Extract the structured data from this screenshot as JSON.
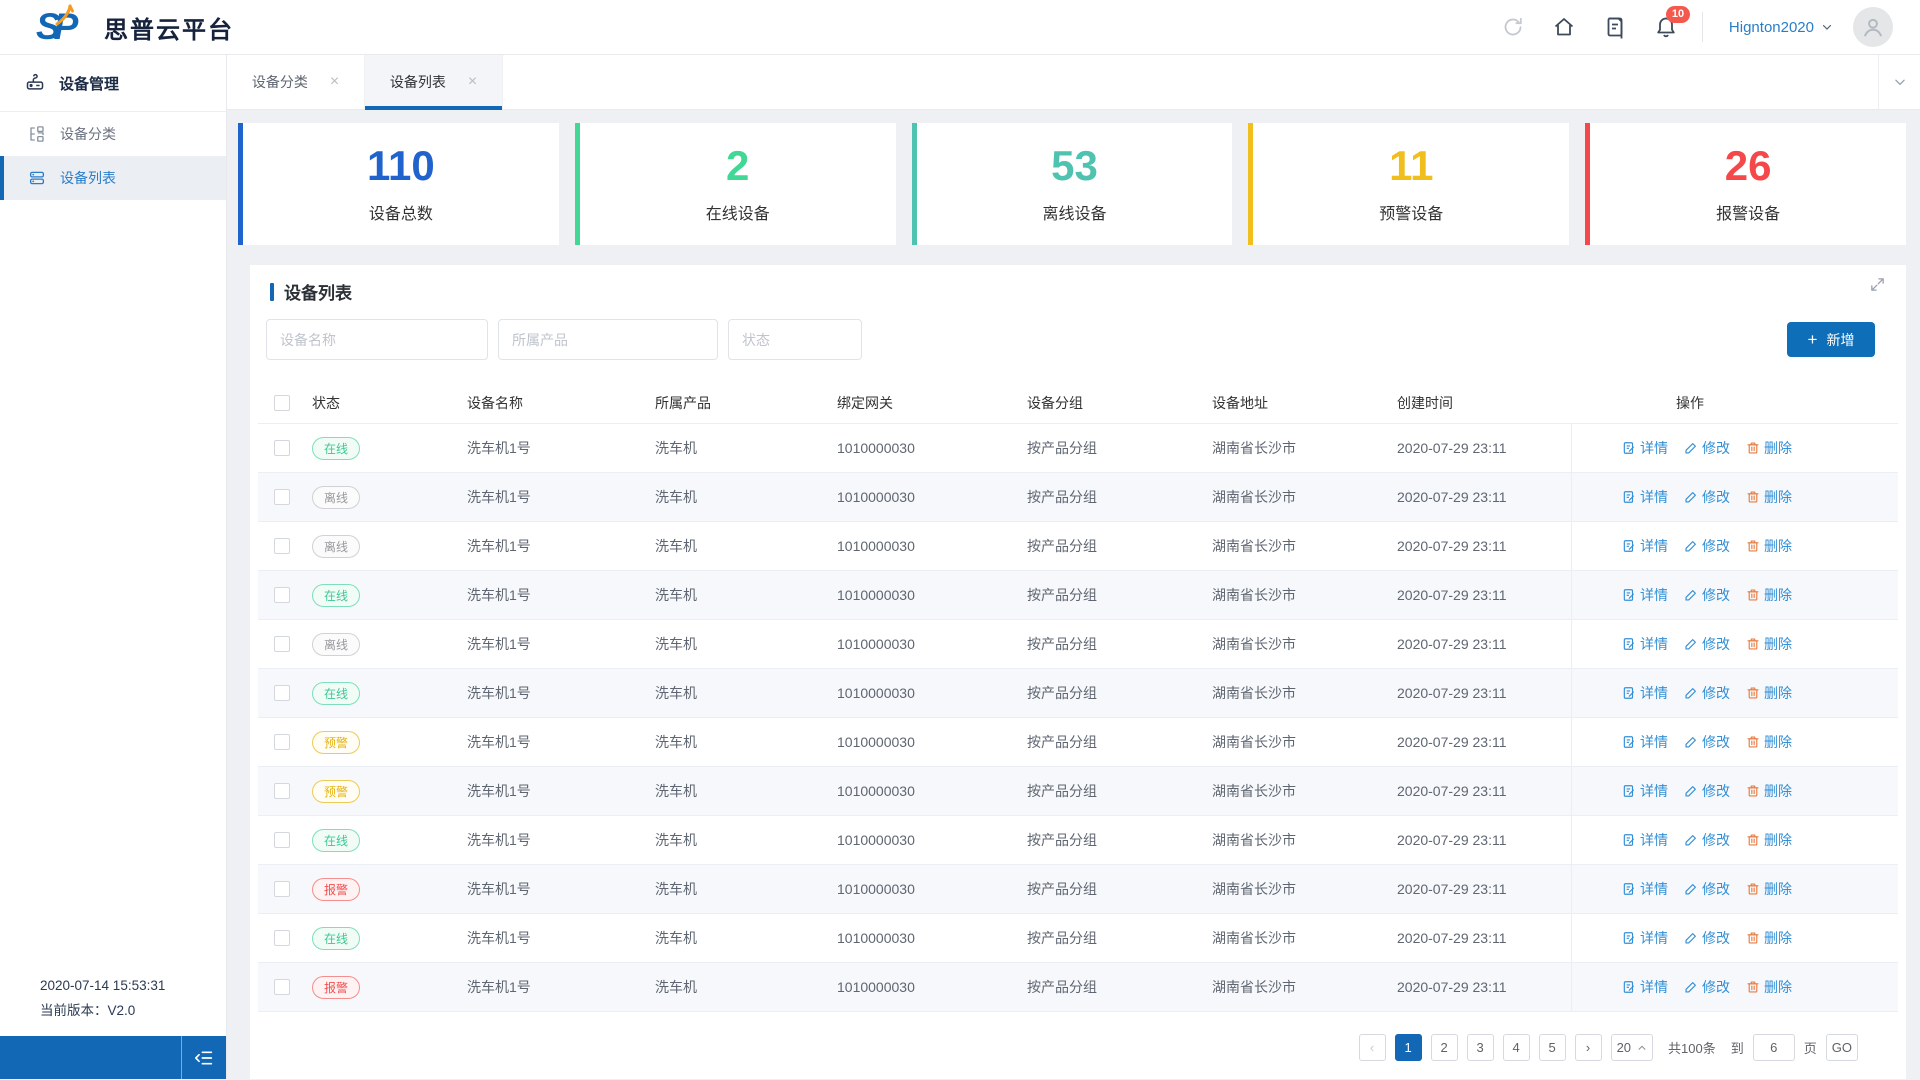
{
  "topbar": {
    "logo_text": "SP",
    "title": "思普云平台",
    "notification_count": "10",
    "username": "Hignton2020"
  },
  "sidebar": {
    "header_label": "设备管理",
    "items": [
      {
        "id": "device-category",
        "label": "设备分类",
        "icon": "category-icon",
        "active": false
      },
      {
        "id": "device-list",
        "label": "设备列表",
        "icon": "device-list-icon",
        "active": true
      }
    ],
    "footer_timestamp": "2020-07-14 15:53:31",
    "footer_version": "当前版本：V2.0"
  },
  "tabs": [
    {
      "id": "device-category",
      "label": "设备分类",
      "active": false
    },
    {
      "id": "device-list",
      "label": "设备列表",
      "active": true
    }
  ],
  "stats": [
    {
      "value": "110",
      "label": "设备总数",
      "color": "#2063cc"
    },
    {
      "value": "2",
      "label": "在线设备",
      "color": "#41d795"
    },
    {
      "value": "53",
      "label": "离线设备",
      "color": "#50c3b0"
    },
    {
      "value": "11",
      "label": "预警设备",
      "color": "#f0bf1d"
    },
    {
      "value": "26",
      "label": "报警设备",
      "color": "#f5484b"
    }
  ],
  "panel": {
    "title": "设备列表",
    "filters": [
      {
        "id": "device-name",
        "placeholder": "设备名称"
      },
      {
        "id": "product",
        "placeholder": "所属产品"
      },
      {
        "id": "status",
        "placeholder": "状态"
      }
    ],
    "add_button_label": "新增"
  },
  "table": {
    "columns": [
      "状态",
      "设备名称",
      "所属产品",
      "绑定网关",
      "设备分组",
      "设备地址",
      "创建时间",
      "操作"
    ],
    "action_labels": {
      "detail": "详情",
      "edit": "修改",
      "delete": "删除"
    },
    "status_styles": {
      "在线": {
        "color": "#3fc793",
        "border": "#7edfba",
        "bg": "#f1fcf7"
      },
      "离线": {
        "color": "#97999c",
        "border": "#cfd2d6",
        "bg": "#fbfbfc"
      },
      "预警": {
        "color": "#e5b311",
        "border": "#eecb55",
        "bg": "#fffdf4"
      },
      "报警": {
        "color": "#f14f4f",
        "border": "#f58e8e",
        "bg": "#fef2f2"
      }
    },
    "rows": [
      {
        "status": "在线",
        "name": "洗车机1号",
        "product": "洗车机",
        "gateway": "1010000030",
        "group": "按产品分组",
        "address": "湖南省长沙市",
        "created": "2020-07-29 23:11"
      },
      {
        "status": "离线",
        "name": "洗车机1号",
        "product": "洗车机",
        "gateway": "1010000030",
        "group": "按产品分组",
        "address": "湖南省长沙市",
        "created": "2020-07-29 23:11"
      },
      {
        "status": "离线",
        "name": "洗车机1号",
        "product": "洗车机",
        "gateway": "1010000030",
        "group": "按产品分组",
        "address": "湖南省长沙市",
        "created": "2020-07-29 23:11"
      },
      {
        "status": "在线",
        "name": "洗车机1号",
        "product": "洗车机",
        "gateway": "1010000030",
        "group": "按产品分组",
        "address": "湖南省长沙市",
        "created": "2020-07-29 23:11"
      },
      {
        "status": "离线",
        "name": "洗车机1号",
        "product": "洗车机",
        "gateway": "1010000030",
        "group": "按产品分组",
        "address": "湖南省长沙市",
        "created": "2020-07-29 23:11"
      },
      {
        "status": "在线",
        "name": "洗车机1号",
        "product": "洗车机",
        "gateway": "1010000030",
        "group": "按产品分组",
        "address": "湖南省长沙市",
        "created": "2020-07-29 23:11"
      },
      {
        "status": "预警",
        "name": "洗车机1号",
        "product": "洗车机",
        "gateway": "1010000030",
        "group": "按产品分组",
        "address": "湖南省长沙市",
        "created": "2020-07-29 23:11"
      },
      {
        "status": "预警",
        "name": "洗车机1号",
        "product": "洗车机",
        "gateway": "1010000030",
        "group": "按产品分组",
        "address": "湖南省长沙市",
        "created": "2020-07-29 23:11"
      },
      {
        "status": "在线",
        "name": "洗车机1号",
        "product": "洗车机",
        "gateway": "1010000030",
        "group": "按产品分组",
        "address": "湖南省长沙市",
        "created": "2020-07-29 23:11"
      },
      {
        "status": "报警",
        "name": "洗车机1号",
        "product": "洗车机",
        "gateway": "1010000030",
        "group": "按产品分组",
        "address": "湖南省长沙市",
        "created": "2020-07-29 23:11"
      },
      {
        "status": "在线",
        "name": "洗车机1号",
        "product": "洗车机",
        "gateway": "1010000030",
        "group": "按产品分组",
        "address": "湖南省长沙市",
        "created": "2020-07-29 23:11"
      },
      {
        "status": "报警",
        "name": "洗车机1号",
        "product": "洗车机",
        "gateway": "1010000030",
        "group": "按产品分组",
        "address": "湖南省长沙市",
        "created": "2020-07-29 23:11"
      }
    ]
  },
  "pagination": {
    "pages": [
      "1",
      "2",
      "3",
      "4",
      "5"
    ],
    "current_page": "1",
    "page_size": "20",
    "total_label": "共100条",
    "to_label": "到",
    "goto_value": "6",
    "page_unit_label": "页",
    "go_label": "GO"
  }
}
